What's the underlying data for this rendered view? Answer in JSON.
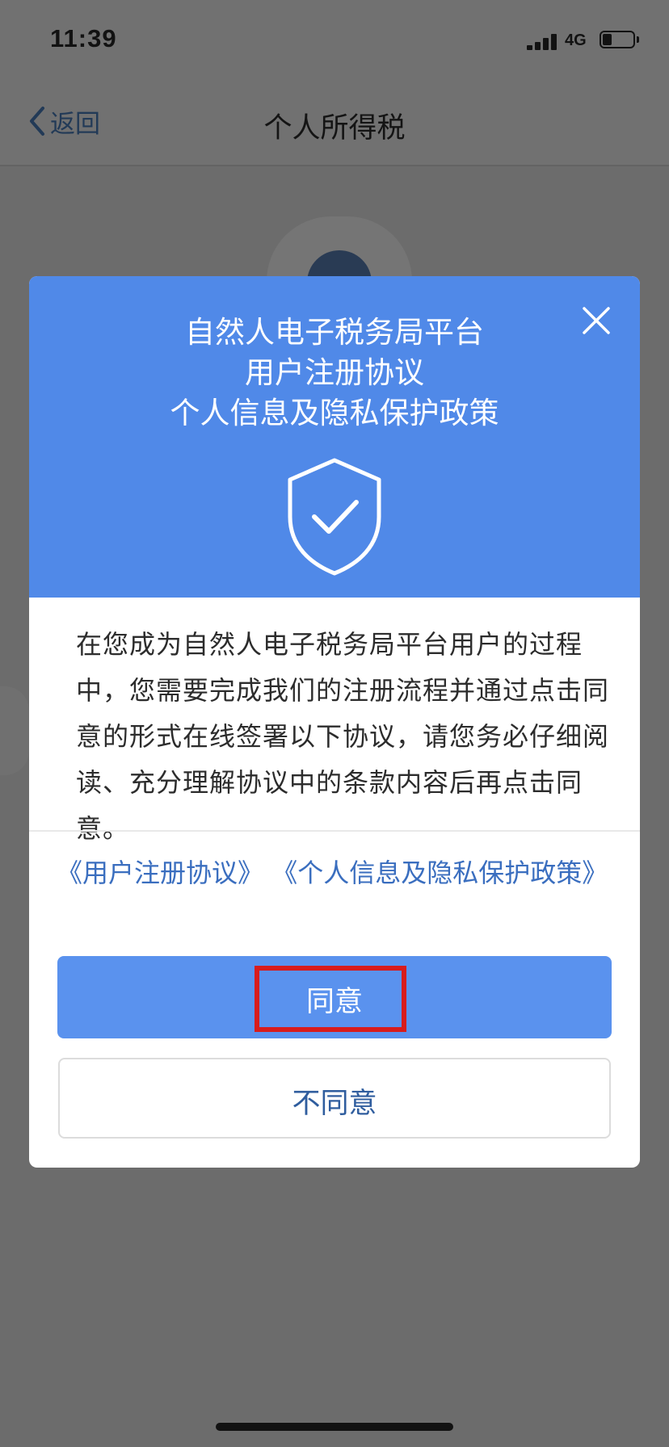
{
  "status_bar": {
    "time": "11:39",
    "network": "4G",
    "battery_level": 0.3
  },
  "nav": {
    "back_label": "返回",
    "title": "个人所得税"
  },
  "dialog": {
    "title_line1": "自然人电子税务局平台",
    "title_line2": "用户注册协议",
    "title_line3": "个人信息及隐私保护政策",
    "body": "在您成为自然人电子税务局平台用户的过程中，您需要完成我们的注册流程并通过点击同意的形式在线签署以下协议，请您务必仔细阅读、充分理解协议中的条款内容后再点击同意。",
    "link_registration": "《用户注册协议》",
    "link_privacy": "《个人信息及隐私保护政策》",
    "agree_label": "同意",
    "disagree_label": "不同意"
  },
  "colors": {
    "header_blue": "#5089e8",
    "agree_button": "#5a92ee",
    "link_blue": "#3a6ebf",
    "highlight_red": "#d81c1c",
    "overlay_gray": "#6c6c6c"
  },
  "icons": {
    "close": "close-icon",
    "shield": "shield-check-icon",
    "back": "chevron-left-icon"
  }
}
